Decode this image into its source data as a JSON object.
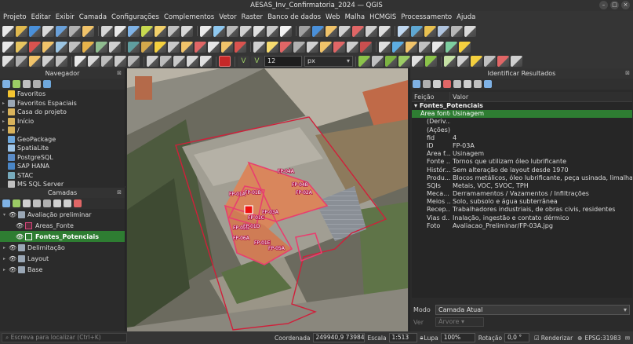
{
  "window": {
    "title": "AESAS_Inv_Confirmatoria_2024 — QGIS"
  },
  "menu": [
    "Projeto",
    "Editar",
    "Exibir",
    "Camada",
    "Configurações",
    "Complementos",
    "Vetor",
    "Raster",
    "Banco de dados",
    "Web",
    "Malha",
    "HCMGIS",
    "Processamento",
    "Ajuda"
  ],
  "digitizing": {
    "tolerance_value": "12",
    "tolerance_unit": "px"
  },
  "browser_panel": {
    "title": "Navegador",
    "items": [
      {
        "label": "Favoritos",
        "icon": "star-icon",
        "color": "#f4c430",
        "expand": ""
      },
      {
        "label": "Favoritos Espaciais",
        "icon": "bookmark-icon",
        "color": "#9aa7b5",
        "expand": "▸"
      },
      {
        "label": "Casa do projeto",
        "icon": "folder-icon",
        "color": "#d9b35b",
        "expand": "▸"
      },
      {
        "label": "Início",
        "icon": "folder-icon",
        "color": "#d9b35b",
        "expand": "▸"
      },
      {
        "label": "/",
        "icon": "folder-icon",
        "color": "#d9b35b",
        "expand": "▸"
      },
      {
        "label": "GeoPackage",
        "icon": "geopackage-icon",
        "color": "#6fa8dc",
        "expand": ""
      },
      {
        "label": "SpatiaLite",
        "icon": "spatialite-icon",
        "color": "#9fc5e8",
        "expand": ""
      },
      {
        "label": "PostgreSQL",
        "icon": "postgresql-icon",
        "color": "#5b8cc7",
        "expand": ""
      },
      {
        "label": "SAP HANA",
        "icon": "database-icon",
        "color": "#4a86c6",
        "expand": ""
      },
      {
        "label": "STAC",
        "icon": "stac-icon",
        "color": "#7ab",
        "expand": ""
      },
      {
        "label": "MS SQL Server",
        "icon": "database-icon",
        "color": "#c0c0c0",
        "expand": ""
      }
    ]
  },
  "layers_panel": {
    "title": "Camadas",
    "groups": [
      {
        "label": "Avaliação preliminar",
        "expand": "▾",
        "children": [
          {
            "label": "Areas_Fonte",
            "color": "#d4477b",
            "selected": false
          },
          {
            "label": "Fontes_Potenciais",
            "color": "#ffffff",
            "selected": true
          }
        ]
      },
      {
        "label": "Delimitação",
        "expand": "▸"
      },
      {
        "label": "Layout",
        "expand": "▸"
      },
      {
        "label": "Base",
        "expand": "▸"
      }
    ]
  },
  "map": {
    "labels": [
      "FP-01A",
      "FP-01B",
      "FP-01C",
      "FP-03A",
      "FP-04A",
      "FP-04B",
      "FP-02A",
      "FP-02B",
      "FP-01D",
      "FP-06A",
      "FP-01E",
      "FP-05A"
    ]
  },
  "identify_panel": {
    "title": "Identificar Resultados",
    "col_feature": "Feição",
    "col_value": "Valor",
    "group": "Fontes_Potenciais",
    "rows": [
      {
        "k": "Área fonte",
        "v": "Usinagem",
        "indent": 1,
        "sel": true
      },
      {
        "k": "(Deriv...",
        "v": "",
        "indent": 2,
        "sel": false
      },
      {
        "k": "(Ações)",
        "v": "",
        "indent": 2,
        "sel": false
      },
      {
        "k": "fid",
        "v": "4",
        "indent": 2,
        "sel": false
      },
      {
        "k": "ID",
        "v": "FP-03A",
        "indent": 2,
        "sel": false
      },
      {
        "k": "Área f...",
        "v": "Usinagem",
        "indent": 2,
        "sel": false
      },
      {
        "k": "Fonte ...",
        "v": "Tornos que utilizam óleo lubrificante",
        "indent": 2,
        "sel": false
      },
      {
        "k": "Histór...",
        "v": "Sem alteração de layout desde 1970",
        "indent": 2,
        "sel": false
      },
      {
        "k": "Produ...",
        "v": "Blocos metálicos, óleo lubrificante, peça usinada, limalha de f...",
        "indent": 2,
        "sel": false
      },
      {
        "k": "SQIs",
        "v": "Metais, VOC, SVOC, TPH",
        "indent": 2,
        "sel": false
      },
      {
        "k": "Meca...",
        "v": "Derramamentos / Vazamentos / Infiltrações",
        "indent": 2,
        "sel": false
      },
      {
        "k": "Meios ...",
        "v": "Solo, subsolo e água subterrânea",
        "indent": 2,
        "sel": false
      },
      {
        "k": "Recep...",
        "v": "Trabalhadores industriais, de obras civis, residentes",
        "indent": 2,
        "sel": false
      },
      {
        "k": "Vias d...",
        "v": "Inalação, ingestão e contato dérmico",
        "indent": 2,
        "sel": false
      },
      {
        "k": "Foto",
        "v": "Avaliacao_Preliminar/FP-03A.jpg",
        "indent": 2,
        "sel": false
      }
    ],
    "mode_label": "Modo",
    "mode_value": "Camada Atual",
    "view_label": "Ver",
    "view_value": "Árvore"
  },
  "statusbar": {
    "locator_placeholder": "Escreva para localizar (Ctrl+K)",
    "coord_label": "Coordenada",
    "coord_value": "249940,9 7398435,2",
    "scale_label": "Escala",
    "scale_value": "1:513",
    "magnifier_label": "Lupa",
    "magnifier_value": "100%",
    "rotation_label": "Rotação",
    "rotation_value": "0,0 °",
    "render_label": "Renderizar",
    "crs_label": "EPSG:31983"
  },
  "toolbar_colors": {
    "row1": [
      "#e8e8e8",
      "#e0b94f",
      "#4a90d9",
      "#d9d9d9",
      "#6aa0d8",
      "#b0b0b0",
      "#f0c36a",
      "#d6d6d6",
      "#e8e8e8",
      "#7fb2e5",
      "#c7d94f",
      "#f2d06b",
      "#c0c0c0",
      "#d8d8d8",
      "#e9e9e9",
      "#8fc8ef",
      "#b8b8b8",
      "#d0d0d0",
      "#e0e0e0",
      "#c8c8c8",
      "#f2f2f2",
      "#a0a0a0",
      "#4a90d9",
      "#f0c36a",
      "#d0d0d0",
      "#e06666",
      "#cfcfcf",
      "#dedede",
      "#c0d8f0",
      "#5fa8d3",
      "#e8c050",
      "#b0c4de",
      "#b7b7b7",
      "#d9d9d9"
    ],
    "row2": [
      "#e8e8e8",
      "#e6c460",
      "#d9534f",
      "#f0c36a",
      "#9bc4e2",
      "#c0c0c0",
      "#e7b34b",
      "#8fbc8f",
      "#d0d0d0",
      "#5f9ea0",
      "#d4a84b",
      "#f4d03f",
      "#c9c9c9",
      "#f0c36a",
      "#e06666",
      "#e6e6e6",
      "#f0c36a",
      "#d9534f",
      "#d0d0d0",
      "#f7dc6f",
      "#e06666",
      "#b0b0b0",
      "#d0d0d0",
      "#f0c36a",
      "#e06666",
      "#ccc",
      "#c94f4f",
      "#e0e0e0",
      "#5dade2",
      "#f0c36a",
      "#c0c0c0",
      "#e8e8e8",
      "#7dcea0",
      "#f4d03f"
    ],
    "row3": [
      "#e0e0e0",
      "#b0b0b0",
      "#f0c36a",
      "#d0d0d0",
      "#c0c0c0",
      "#e8e8e8",
      "#d9d9d9",
      "#bdbdbd",
      "#c9c9c9",
      "#b8b8b8",
      "#d0d0d0",
      "#bcbcbc",
      "#c8c8c8",
      "#d6d6d6",
      "#e0e0e0"
    ],
    "row3b": [
      "#8bc34a",
      "#c0c0c0",
      "#7cb342",
      "#9ccc65",
      "#e0e0e0",
      "#8bc34a",
      "#c5e1a5",
      "#d0d0d0",
      "#f4d03f",
      "#c0c0c0",
      "#e06666",
      "#d0d0d0"
    ]
  }
}
